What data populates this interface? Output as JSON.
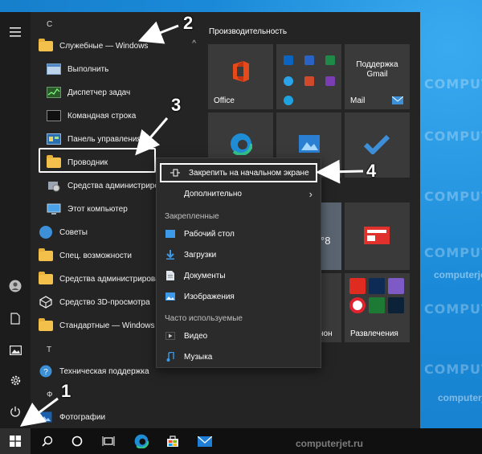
{
  "desktop": {
    "watermarks": [
      "COMPUTERJET",
      "computerjet.ru"
    ]
  },
  "start_menu": {
    "rail": {
      "hamburger_icon": "hamburger-icon",
      "bottom_icons": [
        "user-icon",
        "document-icon",
        "pictures-icon",
        "settings-icon",
        "power-icon"
      ]
    },
    "group_c": "С",
    "group_t": "Т",
    "group_f": "Ф",
    "apps": [
      {
        "label": "Служебные — Windows",
        "icon": "folder",
        "sub": false,
        "chevron": "^"
      },
      {
        "label": "Выполнить",
        "icon": "run",
        "sub": true
      },
      {
        "label": "Диспетчер задач",
        "icon": "taskmgr",
        "sub": true
      },
      {
        "label": "Командная строка",
        "icon": "cmd",
        "sub": true
      },
      {
        "label": "Панель управления",
        "icon": "control",
        "sub": true
      },
      {
        "label": "Проводник",
        "icon": "folder",
        "sub": true
      },
      {
        "label": "Средства администрирования Windows",
        "icon": "admin",
        "sub": true
      },
      {
        "label": "Этот компьютер",
        "icon": "pc",
        "sub": true
      },
      {
        "label": "Советы",
        "icon": "tips",
        "sub": false
      },
      {
        "label": "Спец. возможности",
        "icon": "folder",
        "sub": false
      },
      {
        "label": "Средства администрирования",
        "icon": "folder",
        "sub": false
      },
      {
        "label": "Средство 3D-просмотра",
        "icon": "3d",
        "sub": false
      },
      {
        "label": "Стандартные — Windows",
        "icon": "folder",
        "sub": false
      },
      {
        "label": "Техническая поддержка",
        "icon": "support",
        "sub": false
      },
      {
        "label": "Фотографии",
        "icon": "photos",
        "sub": false
      }
    ]
  },
  "tiles": {
    "section_title": "Производительность",
    "office": "Office",
    "mail_tile_text": "Поддержка Gmail",
    "mail": "Mail",
    "weather_temp": "°8",
    "explorer_tile_suffix": "нон",
    "entertainment": "Развлечения"
  },
  "context_menu": {
    "pin": "Закрепить на начальном экране",
    "more": "Дополнительно",
    "pinned_header": "Закрепленные",
    "pinned": [
      "Рабочий стол",
      "Загрузки",
      "Документы",
      "Изображения"
    ],
    "frequent_header": "Часто используемые",
    "frequent": [
      "Видео",
      "Музыка"
    ]
  },
  "annotations": [
    "1",
    "2",
    "3",
    "4"
  ],
  "colors": {
    "start_bg": "#242424",
    "tile_bg": "#3a3a3a",
    "desktop": "#1a8ad8",
    "folder": "#f3c14b"
  }
}
